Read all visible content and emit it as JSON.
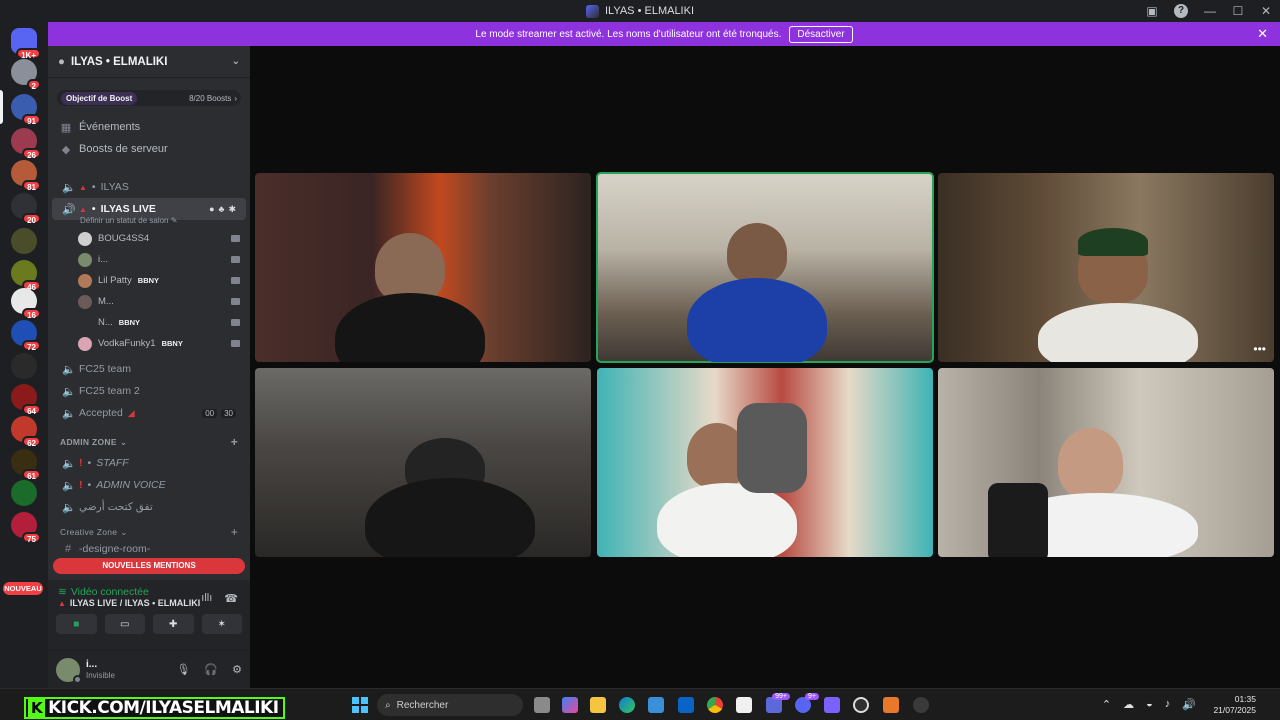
{
  "window": {
    "title": "ILYAS • ELMALIKI"
  },
  "banner": {
    "text": "Le mode streamer est activé. Les noms d'utilisateur ont été tronqués.",
    "button": "Désactiver"
  },
  "rail": {
    "servers": [
      {
        "badge": "1K+",
        "color": "#5865f2"
      },
      {
        "badge": "2",
        "color": "#8a8f99"
      },
      {
        "badge": "91",
        "color": "#3b5db0"
      },
      {
        "badge": "26",
        "color": "#9c3b4f"
      },
      {
        "badge": "81",
        "color": "#b55b3a"
      },
      {
        "badge": "20",
        "color": "#2f3136"
      },
      {
        "badge": "",
        "color": "#4a4d2a"
      },
      {
        "badge": "46",
        "color": "#6b7a1e"
      },
      {
        "badge": "16",
        "color": "#e8e8e8"
      },
      {
        "badge": "72",
        "color": "#1f4fb5"
      },
      {
        "badge": "",
        "color": "#2a2a2a"
      },
      {
        "badge": "64",
        "color": "#8b1a1a"
      },
      {
        "badge": "62",
        "color": "#c0392b"
      },
      {
        "badge": "61",
        "color": "#3a2e12"
      },
      {
        "badge": "",
        "color": "#1b6b2a"
      },
      {
        "badge": "75",
        "color": "#b31f3a"
      }
    ],
    "nouveau": "NOUVEAU"
  },
  "server": {
    "name": "ILYAS • ELMALIKI",
    "boost_goal": "Objectif de Boost",
    "boost_count": "8/20 Boosts",
    "events": "Événements",
    "boosts": "Boosts de serveur"
  },
  "channels": {
    "ilyas": "ILYAS",
    "ilyas_live": "ILYAS LIVE",
    "status_hint": "Définir un statut de salon",
    "users": [
      {
        "name": "BOUG4SS4",
        "tag": "",
        "color": "#cfcfcf"
      },
      {
        "name": "i...",
        "tag": "",
        "color": "#7a8a6d"
      },
      {
        "name": "Lil Patty",
        "tag": "BBNY",
        "color": "#b07a5a"
      },
      {
        "name": "M...",
        "tag": "",
        "color": "#6b5a5a"
      },
      {
        "name": "N...",
        "tag": "BBNY",
        "color": "#2b2d31"
      },
      {
        "name": "VodkaFunky1",
        "tag": "BBNY",
        "color": "#d9a5b5"
      }
    ],
    "fc25": "FC25 team",
    "fc25_2": "FC25 team 2",
    "accepted": "Accepted",
    "accepted_n1": "00",
    "accepted_n2": "30",
    "admin_zone": "ADMIN ZONE",
    "staff": "STAFF",
    "admin_voice": "ADMIN VOICE",
    "arabic": "تفق كتحت أرضي",
    "creative_zone": "Creative Zone",
    "designe_room": "-designe-room-",
    "mentions": "NOUVELLES MENTIONS"
  },
  "voice": {
    "status": "Vidéo connectée",
    "location": "ILYAS LIVE / ILYAS • ELMALIKI"
  },
  "account": {
    "name": "i...",
    "status": "Invisible"
  },
  "taskbar": {
    "kick": "KICK.COM/ILYASELMALIKI",
    "search": "Rechercher",
    "badge_store": "99+",
    "badge_discord": "9+",
    "time": "01:35",
    "date": "21/07/2025"
  },
  "colors": {
    "accent": "#5865f2",
    "banner": "#8e32dd",
    "online": "#23a55a",
    "danger": "#f23f43"
  }
}
